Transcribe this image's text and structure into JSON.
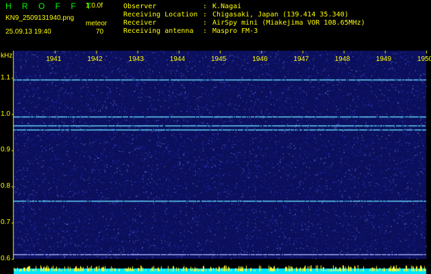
{
  "header": {
    "app_title": "H R O F F T",
    "version": "1.0.0f",
    "filename": "KN9_2509131940.png",
    "software": "meteor",
    "datetime": "25.09.13 19:40",
    "count": "70",
    "info": [
      {
        "key": "Observer",
        "sep": ":",
        "value": "K.Nagai"
      },
      {
        "key": "Receiving Location",
        "sep": ":",
        "value": "Chigasaki, Japan (139.414 35.340)"
      },
      {
        "key": "Receiver",
        "sep": ":",
        "value": "AirSpy mini (Miakejima VOR 108.65MHz)"
      },
      {
        "key": "Receiving antenna",
        "sep": ":",
        "value": "Maspro FM-3"
      }
    ]
  },
  "chart_data": {
    "type": "heatmap",
    "ylabel": "kHz",
    "y_ticks": [
      "1.1",
      "1.0",
      "0.9",
      "0.8",
      "0.7",
      "0.6"
    ],
    "x_ticks": [
      "1941",
      "1942",
      "1943",
      "1944",
      "1945",
      "1946",
      "1947",
      "1948",
      "1949",
      "1950"
    ],
    "x_range": [
      1940,
      1950
    ],
    "y_range": [
      0.6,
      1.16
    ],
    "carrier_lines_khz": [
      1.096,
      0.993,
      0.968,
      0.958,
      0.76,
      0.614
    ],
    "colors": {
      "background": "#0b0f5c",
      "noise": "#3a48e0",
      "carrier": "#66e0ff",
      "bottom_bar": "#00e5ff",
      "bottom_noise": "#ffff33",
      "labels": "#ffff00"
    }
  }
}
